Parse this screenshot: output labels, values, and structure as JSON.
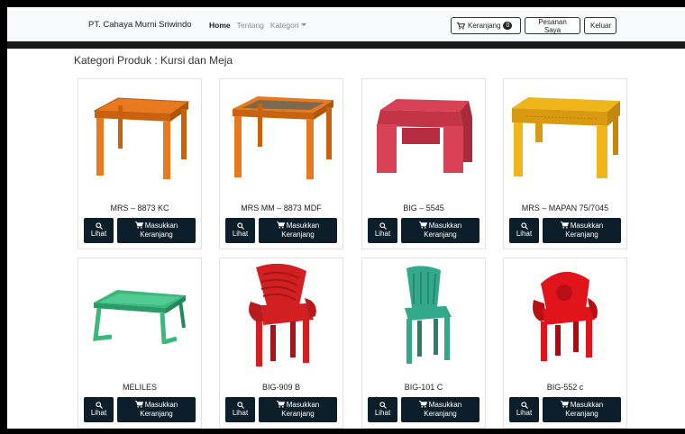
{
  "navbar": {
    "brand": "PT. Cahaya Murni Sriwindo",
    "links": [
      {
        "label": "Home",
        "active": true
      },
      {
        "label": "Tentang",
        "active": false
      },
      {
        "label": "Kategori",
        "active": false
      }
    ],
    "cart_label": "Keranjang",
    "cart_count": "0",
    "orders_label": "Pesanan Saya",
    "logout_label": "Keluar"
  },
  "page": {
    "title": "Kategori Produk : Kursi dan Meja"
  },
  "buttons": {
    "view_label": "Lihat",
    "add_line1": "Masukkan",
    "add_line2": "Keranjang"
  },
  "products": [
    {
      "name": "MRS – 8873 KC",
      "color": "#e8791e",
      "kind": "table-square"
    },
    {
      "name": "MRS MM – 8873 MDF",
      "color": "#e8791e",
      "kind": "table-square-dark"
    },
    {
      "name": "BIG – 5545",
      "color": "#d84156",
      "kind": "table-low"
    },
    {
      "name": "MRS – MAPAN 75/7045",
      "color": "#f0b51b",
      "kind": "table-rect"
    },
    {
      "name": "MELILES",
      "color": "#3bb87c",
      "kind": "table-tray"
    },
    {
      "name": "BIG-909 B",
      "color": "#d11f22",
      "kind": "chair-arm"
    },
    {
      "name": "BIG-101 C",
      "color": "#33a88a",
      "kind": "chair-plain"
    },
    {
      "name": "BIG-552 c",
      "color": "#e1131b",
      "kind": "chair-round"
    }
  ]
}
